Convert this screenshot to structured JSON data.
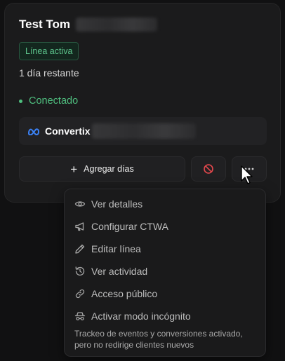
{
  "line": {
    "title": "Test Tom",
    "badge": "Línea activa",
    "days_remaining": "1 día restante",
    "status": "Conectado",
    "status_color": "#4fbf7f"
  },
  "channel": {
    "name": "Convertix",
    "icon": "meta-icon",
    "brand_color": "#3b82f6"
  },
  "actions": {
    "add_days_label": "Agregar días",
    "block_icon": "block-icon",
    "block_color": "#e5484d",
    "more_icon": "more-icon"
  },
  "menu": {
    "items": [
      {
        "label": "Ver detalles",
        "icon": "eye-icon"
      },
      {
        "label": "Configurar CTWA",
        "icon": "megaphone-icon"
      },
      {
        "label": "Editar línea",
        "icon": "pencil-icon"
      },
      {
        "label": "Ver actividad",
        "icon": "history-icon"
      },
      {
        "label": "Acceso público",
        "icon": "link-icon"
      },
      {
        "label": "Activar modo incógnito",
        "icon": "incognito-icon"
      }
    ],
    "note": "Trackeo de eventos y conversiones activado, pero no redirige clientes nuevos"
  }
}
